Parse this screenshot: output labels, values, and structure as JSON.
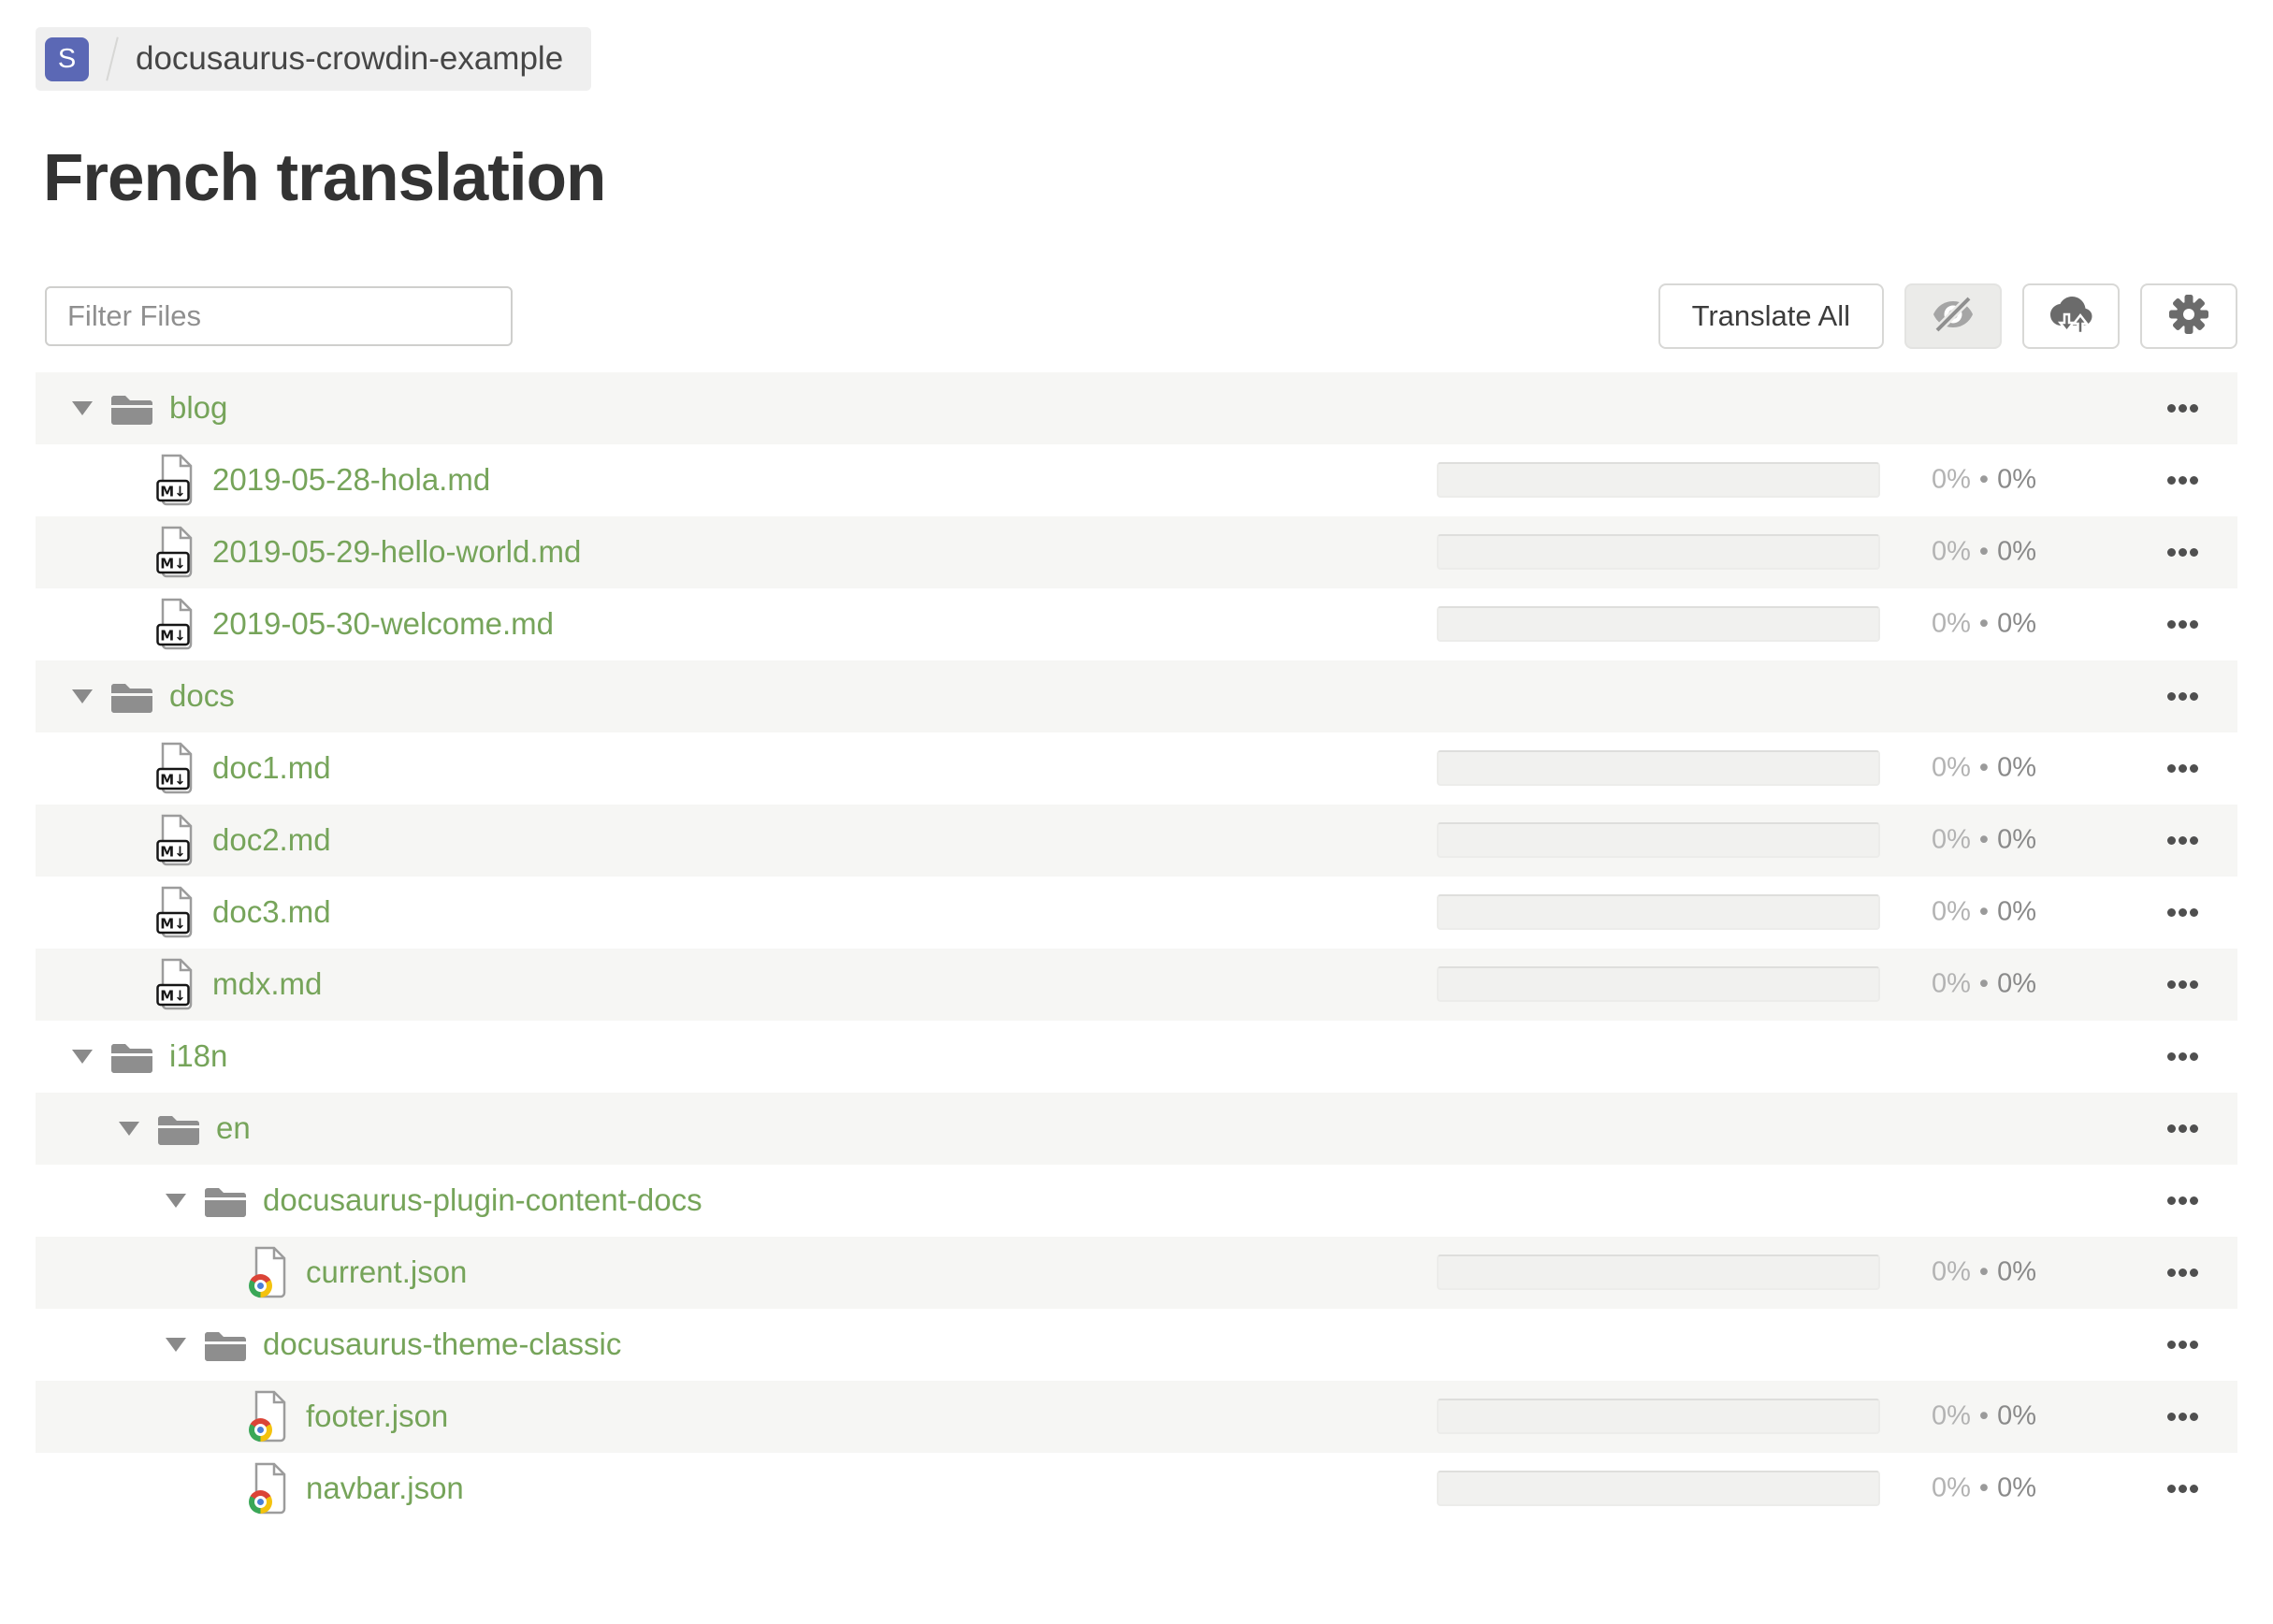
{
  "breadcrumb": {
    "avatar_letter": "S",
    "project_name": "docusaurus-crowdin-example"
  },
  "page_title": "French translation",
  "toolbar": {
    "filter_placeholder": "Filter Files",
    "translate_all_label": "Translate All",
    "buttons": [
      "eye-off-icon",
      "cloud-download-upload-icon",
      "gear-icon"
    ]
  },
  "percent_separator": "•",
  "colors": {
    "link_green": "#76a45a",
    "folder_gray": "#8e8e8e",
    "stripe_bg": "#f6f6f4",
    "breadcrumb_bg": "#efefef",
    "avatar_indigo": "#5b68b5",
    "title_text": "#333333",
    "progress_track": "#f1f1ef",
    "percent_light": "#b3b3b3",
    "percent_dark": "#8a8a8a"
  },
  "tree": {
    "rows": [
      {
        "type": "folder",
        "name": "blog",
        "level": 0,
        "expanded": true
      },
      {
        "type": "file",
        "kind": "md",
        "name": "2019-05-28-hola.md",
        "level": 1,
        "translated": "0%",
        "approved": "0%"
      },
      {
        "type": "file",
        "kind": "md",
        "name": "2019-05-29-hello-world.md",
        "level": 1,
        "translated": "0%",
        "approved": "0%"
      },
      {
        "type": "file",
        "kind": "md",
        "name": "2019-05-30-welcome.md",
        "level": 1,
        "translated": "0%",
        "approved": "0%"
      },
      {
        "type": "folder",
        "name": "docs",
        "level": 0,
        "expanded": true
      },
      {
        "type": "file",
        "kind": "md",
        "name": "doc1.md",
        "level": 1,
        "translated": "0%",
        "approved": "0%"
      },
      {
        "type": "file",
        "kind": "md",
        "name": "doc2.md",
        "level": 1,
        "translated": "0%",
        "approved": "0%"
      },
      {
        "type": "file",
        "kind": "md",
        "name": "doc3.md",
        "level": 1,
        "translated": "0%",
        "approved": "0%"
      },
      {
        "type": "file",
        "kind": "md",
        "name": "mdx.md",
        "level": 1,
        "translated": "0%",
        "approved": "0%"
      },
      {
        "type": "folder",
        "name": "i18n",
        "level": 0,
        "expanded": true
      },
      {
        "type": "folder",
        "name": "en",
        "level": 1,
        "expanded": true
      },
      {
        "type": "folder",
        "name": "docusaurus-plugin-content-docs",
        "level": 2,
        "expanded": true
      },
      {
        "type": "file",
        "kind": "json",
        "name": "current.json",
        "level": 3,
        "translated": "0%",
        "approved": "0%"
      },
      {
        "type": "folder",
        "name": "docusaurus-theme-classic",
        "level": 2,
        "expanded": true
      },
      {
        "type": "file",
        "kind": "json",
        "name": "footer.json",
        "level": 3,
        "translated": "0%",
        "approved": "0%"
      },
      {
        "type": "file",
        "kind": "json",
        "name": "navbar.json",
        "level": 3,
        "translated": "0%",
        "approved": "0%"
      }
    ]
  }
}
